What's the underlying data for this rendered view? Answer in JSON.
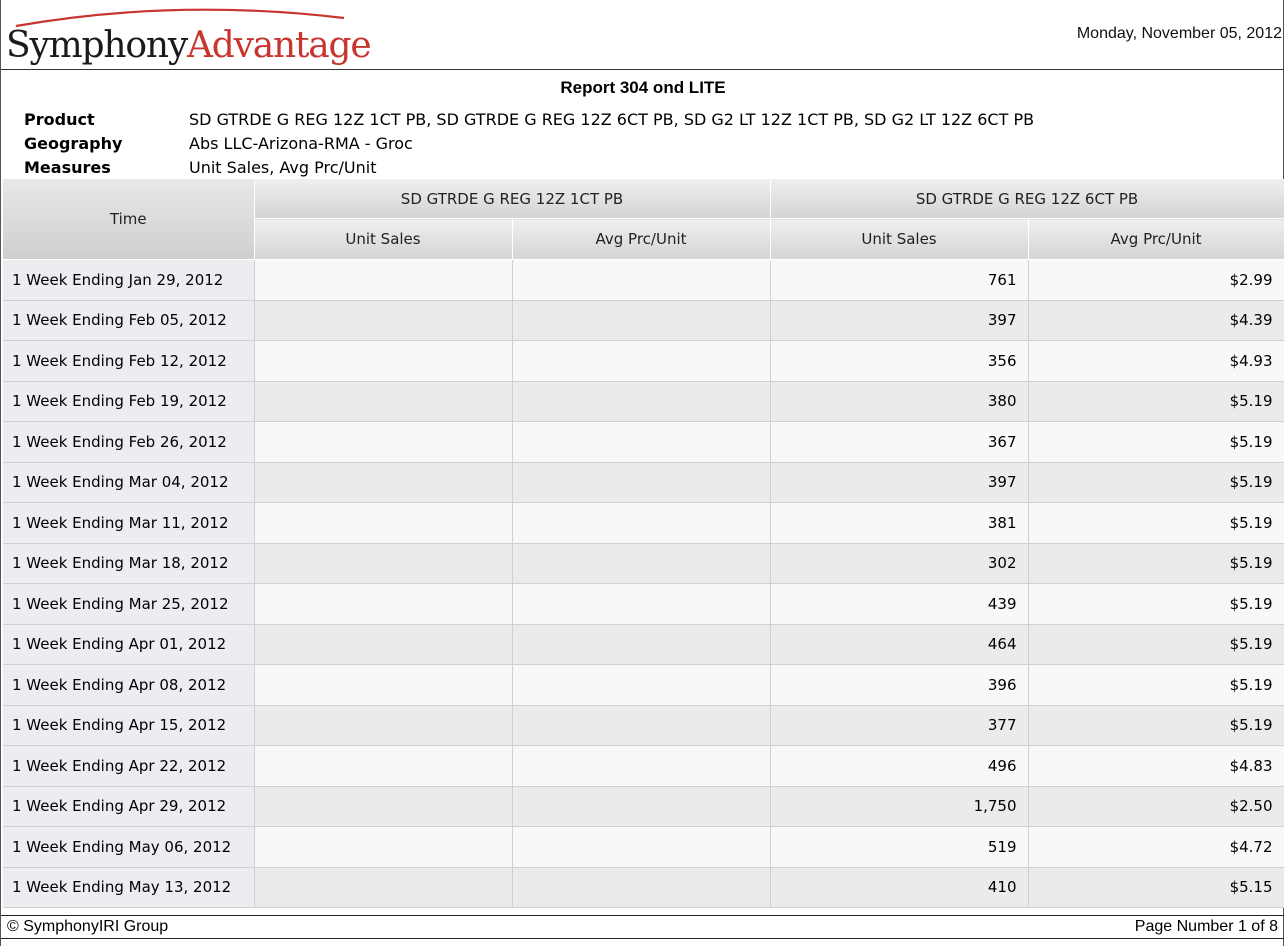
{
  "header": {
    "logo_part1": "Symphony",
    "logo_part2": "Advantage",
    "date": "Monday, November 05, 2012"
  },
  "report": {
    "title": "Report 304 ond LITE",
    "product_label": "Product",
    "product_value": "SD GTRDE G REG 12Z 1CT PB, SD GTRDE G REG 12Z 6CT PB, SD G2 LT 12Z 1CT PB, SD G2 LT 12Z 6CT PB",
    "geography_label": "Geography",
    "geography_value": "Abs LLC-Arizona-RMA - Groc",
    "measures_label": "Measures",
    "measures_value": "Unit Sales, Avg Prc/Unit"
  },
  "table": {
    "time_header": "Time",
    "groups": [
      "SD GTRDE G REG 12Z 1CT PB",
      "SD GTRDE G REG 12Z 6CT PB"
    ],
    "measures": [
      "Unit Sales",
      "Avg Prc/Unit",
      "Unit Sales",
      "Avg Prc/Unit"
    ],
    "rows": [
      [
        "1 Week Ending Jan 29, 2012",
        "",
        "",
        "761",
        "$2.99"
      ],
      [
        "1 Week Ending Feb 05, 2012",
        "",
        "",
        "397",
        "$4.39"
      ],
      [
        "1 Week Ending Feb 12, 2012",
        "",
        "",
        "356",
        "$4.93"
      ],
      [
        "1 Week Ending Feb 19, 2012",
        "",
        "",
        "380",
        "$5.19"
      ],
      [
        "1 Week Ending Feb 26, 2012",
        "",
        "",
        "367",
        "$5.19"
      ],
      [
        "1 Week Ending Mar 04, 2012",
        "",
        "",
        "397",
        "$5.19"
      ],
      [
        "1 Week Ending Mar 11, 2012",
        "",
        "",
        "381",
        "$5.19"
      ],
      [
        "1 Week Ending Mar 18, 2012",
        "",
        "",
        "302",
        "$5.19"
      ],
      [
        "1 Week Ending Mar 25, 2012",
        "",
        "",
        "439",
        "$5.19"
      ],
      [
        "1 Week Ending Apr 01, 2012",
        "",
        "",
        "464",
        "$5.19"
      ],
      [
        "1 Week Ending Apr 08, 2012",
        "",
        "",
        "396",
        "$5.19"
      ],
      [
        "1 Week Ending Apr 15, 2012",
        "",
        "",
        "377",
        "$5.19"
      ],
      [
        "1 Week Ending Apr 22, 2012",
        "",
        "",
        "496",
        "$4.83"
      ],
      [
        "1 Week Ending Apr 29, 2012",
        "",
        "",
        "1,750",
        "$2.50"
      ],
      [
        "1 Week Ending May 06, 2012",
        "",
        "",
        "519",
        "$4.72"
      ],
      [
        "1 Week Ending May 13, 2012",
        "",
        "",
        "410",
        "$5.15"
      ]
    ]
  },
  "footer": {
    "copyright": "© SymphonyIRI Group",
    "page_number": "Page Number 1 of 8"
  },
  "colors": {
    "logo_arc": "#c8352f",
    "logo_accent": "#c8352f"
  }
}
